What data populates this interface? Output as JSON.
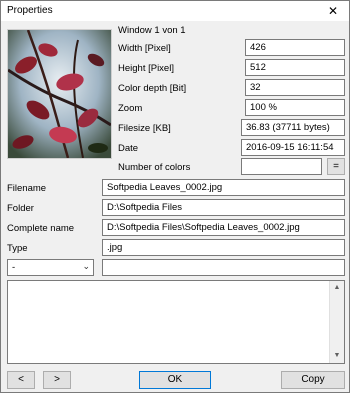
{
  "window": {
    "title": "Properties",
    "close_glyph": "✕"
  },
  "image_info": {
    "window_label": "Window 1 von 1"
  },
  "properties": [
    {
      "label": "Width [Pixel]",
      "value": "426"
    },
    {
      "label": "Height [Pixel]",
      "value": "512"
    },
    {
      "label": "Color depth [Bit]",
      "value": "32"
    },
    {
      "label": "Zoom",
      "value": "100 %"
    },
    {
      "label": "Filesize [KB]",
      "value": "36.83 (37711 bytes)"
    },
    {
      "label": "Date",
      "value": "2016-09-15 16:11:54"
    },
    {
      "label": "Number of colors",
      "value": ""
    }
  ],
  "count_button": {
    "label": "="
  },
  "file": [
    {
      "label": "Filename",
      "value": "Softpedia Leaves_0002.jpg"
    },
    {
      "label": "Folder",
      "value": "D:\\Softpedia Files"
    },
    {
      "label": "Complete name",
      "value": "D:\\Softpedia Files\\Softpedia Leaves_0002.jpg"
    },
    {
      "label": "Type",
      "value": ".jpg"
    }
  ],
  "dropdown": {
    "selected": "-",
    "arrow_glyph": "⌄"
  },
  "extra_field": {
    "value": ""
  },
  "notes": {
    "value": ""
  },
  "scrollbar": {
    "up_glyph": "▲",
    "down_glyph": "▼"
  },
  "footer": {
    "prev_label": "<",
    "next_label": ">",
    "ok_label": "OK",
    "copy_label": "Copy"
  },
  "colors": {
    "window_bg": "#f0f0f0",
    "accent": "#0078d7"
  },
  "icons": {
    "thumbnail": "photo-thumbnail-leaves"
  }
}
